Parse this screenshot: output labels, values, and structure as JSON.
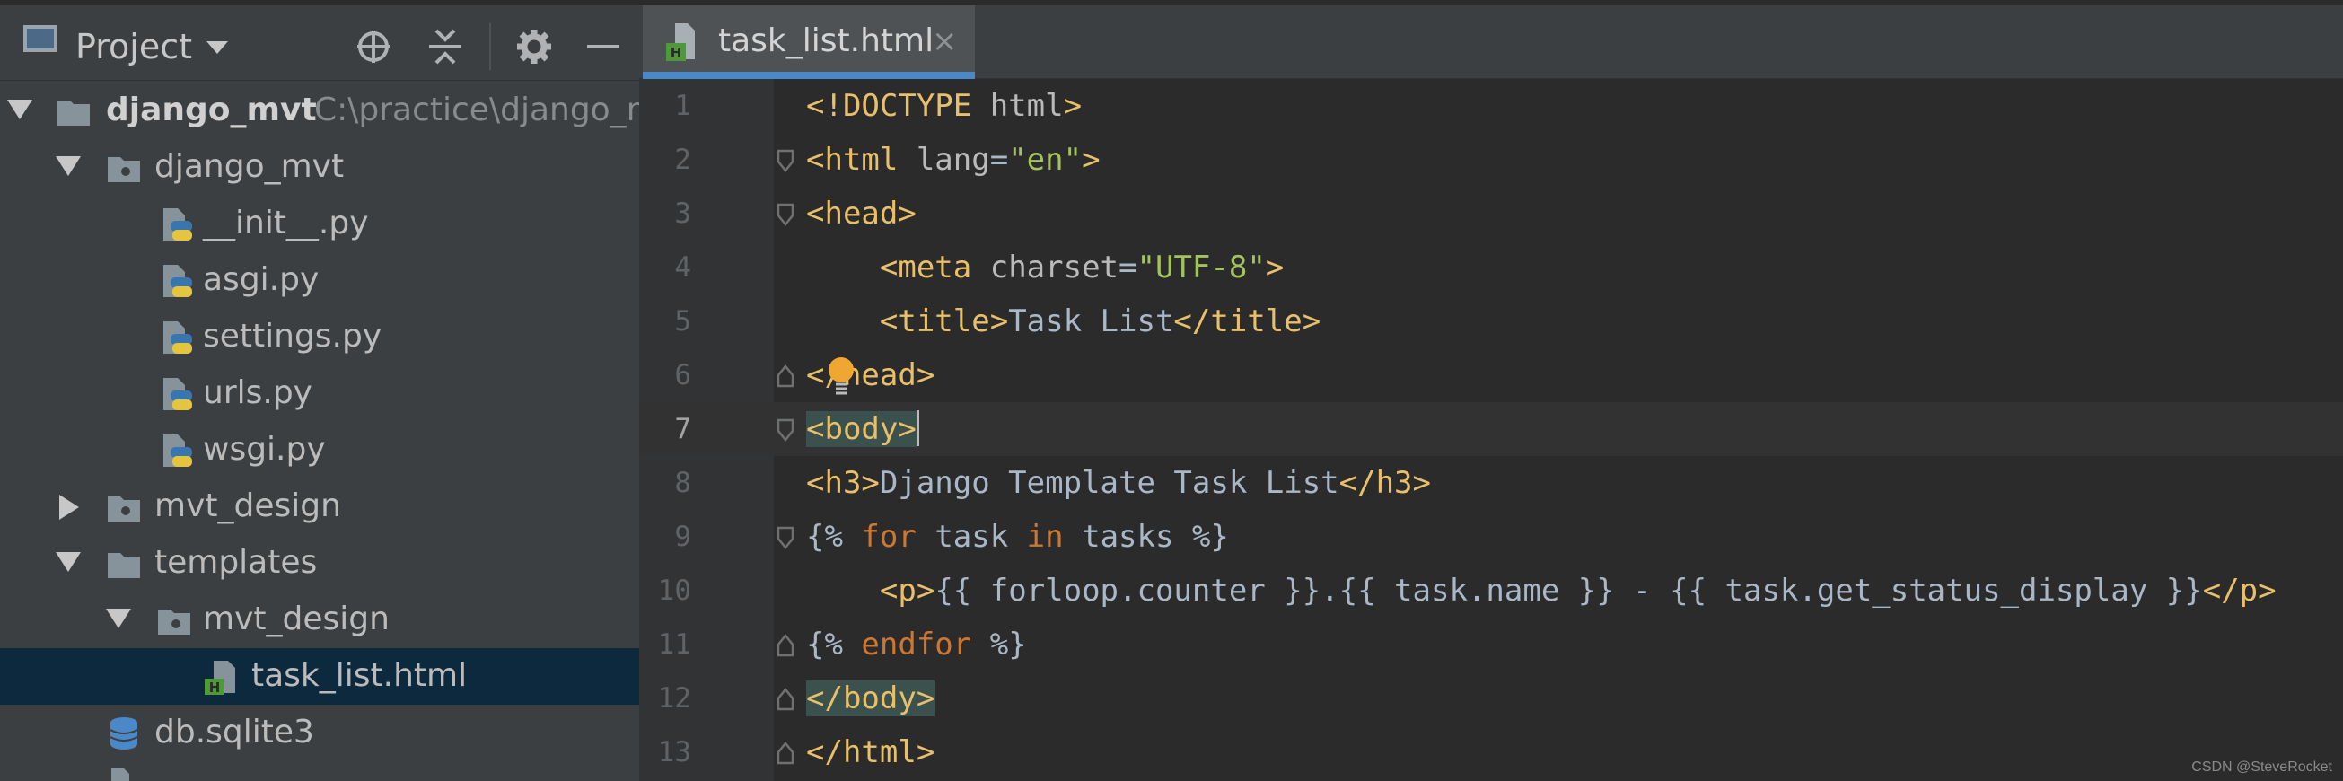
{
  "project_panel": {
    "title": "Project",
    "tree": [
      {
        "label": "django_mvt",
        "path": "C:\\practice\\django_m",
        "expanded": true,
        "type": "project"
      },
      {
        "label": "django_mvt",
        "expanded": true,
        "type": "package"
      },
      {
        "label": "__init__.py",
        "type": "python"
      },
      {
        "label": "asgi.py",
        "type": "python"
      },
      {
        "label": "settings.py",
        "type": "python"
      },
      {
        "label": "urls.py",
        "type": "python"
      },
      {
        "label": "wsgi.py",
        "type": "python"
      },
      {
        "label": "mvt_design",
        "expanded": false,
        "type": "package"
      },
      {
        "label": "templates",
        "expanded": true,
        "type": "folder"
      },
      {
        "label": "mvt_design",
        "expanded": true,
        "type": "package"
      },
      {
        "label": "task_list.html",
        "type": "html",
        "selected": true
      },
      {
        "label": "db.sqlite3",
        "type": "database"
      }
    ]
  },
  "editor": {
    "active_tab": "task_list.html",
    "close_glyph": "×",
    "current_line": 7,
    "lines": [
      {
        "n": "1",
        "tokens": [
          [
            "t-tag",
            "<!DOCTYPE"
          ],
          [
            "t-attr",
            " html"
          ],
          [
            "t-tag",
            ">"
          ]
        ]
      },
      {
        "n": "2",
        "tokens": [
          [
            "t-tag",
            "<html"
          ],
          [
            "t-attr",
            " lang"
          ],
          [
            "t-text",
            "="
          ],
          [
            "t-val",
            "\"en\""
          ],
          [
            "t-tag",
            ">"
          ]
        ]
      },
      {
        "n": "3",
        "tokens": [
          [
            "t-tag",
            "<head>"
          ]
        ]
      },
      {
        "n": "4",
        "tokens": [
          [
            "t-text",
            "    "
          ],
          [
            "t-tag",
            "<meta"
          ],
          [
            "t-attr",
            " charset"
          ],
          [
            "t-text",
            "="
          ],
          [
            "t-val",
            "\"UTF-8\""
          ],
          [
            "t-tag",
            ">"
          ]
        ]
      },
      {
        "n": "5",
        "tokens": [
          [
            "t-text",
            "    "
          ],
          [
            "t-tag",
            "<title>"
          ],
          [
            "t-text",
            "Task List"
          ],
          [
            "t-tag",
            "</title>"
          ]
        ]
      },
      {
        "n": "6",
        "tokens": [
          [
            "t-tag",
            "</head>"
          ]
        ]
      },
      {
        "n": "7",
        "tokens": [
          [
            "t-tag hl",
            "<body>"
          ]
        ]
      },
      {
        "n": "8",
        "tokens": [
          [
            "t-tag",
            "<h3>"
          ],
          [
            "t-text",
            "Django Template Task List"
          ],
          [
            "t-tag",
            "</h3>"
          ]
        ]
      },
      {
        "n": "9",
        "tokens": [
          [
            "t-text",
            "{% "
          ],
          [
            "t-kw",
            "for"
          ],
          [
            "t-text",
            " task "
          ],
          [
            "t-kw",
            "in"
          ],
          [
            "t-text",
            " tasks %}"
          ]
        ]
      },
      {
        "n": "10",
        "tokens": [
          [
            "t-text",
            "    "
          ],
          [
            "t-tag",
            "<p>"
          ],
          [
            "t-text",
            "{{ forloop.counter }}.{{ task.name }} - {{ task.get_status_display }}"
          ],
          [
            "t-tag",
            "</p>"
          ]
        ]
      },
      {
        "n": "11",
        "tokens": [
          [
            "t-text",
            "{% "
          ],
          [
            "t-kw",
            "endfor"
          ],
          [
            "t-text",
            " %}"
          ]
        ]
      },
      {
        "n": "12",
        "tokens": [
          [
            "t-tag hl",
            "</body>"
          ]
        ]
      },
      {
        "n": "13",
        "tokens": [
          [
            "t-tag",
            "</html>"
          ]
        ]
      }
    ]
  },
  "watermark": "CSDN @SteveRocket",
  "colors": {
    "selection": "#0d293e",
    "tab_underline": "#4a88c7",
    "tag": "#e8bf6a",
    "string": "#a5c261",
    "keyword": "#cc7832"
  }
}
